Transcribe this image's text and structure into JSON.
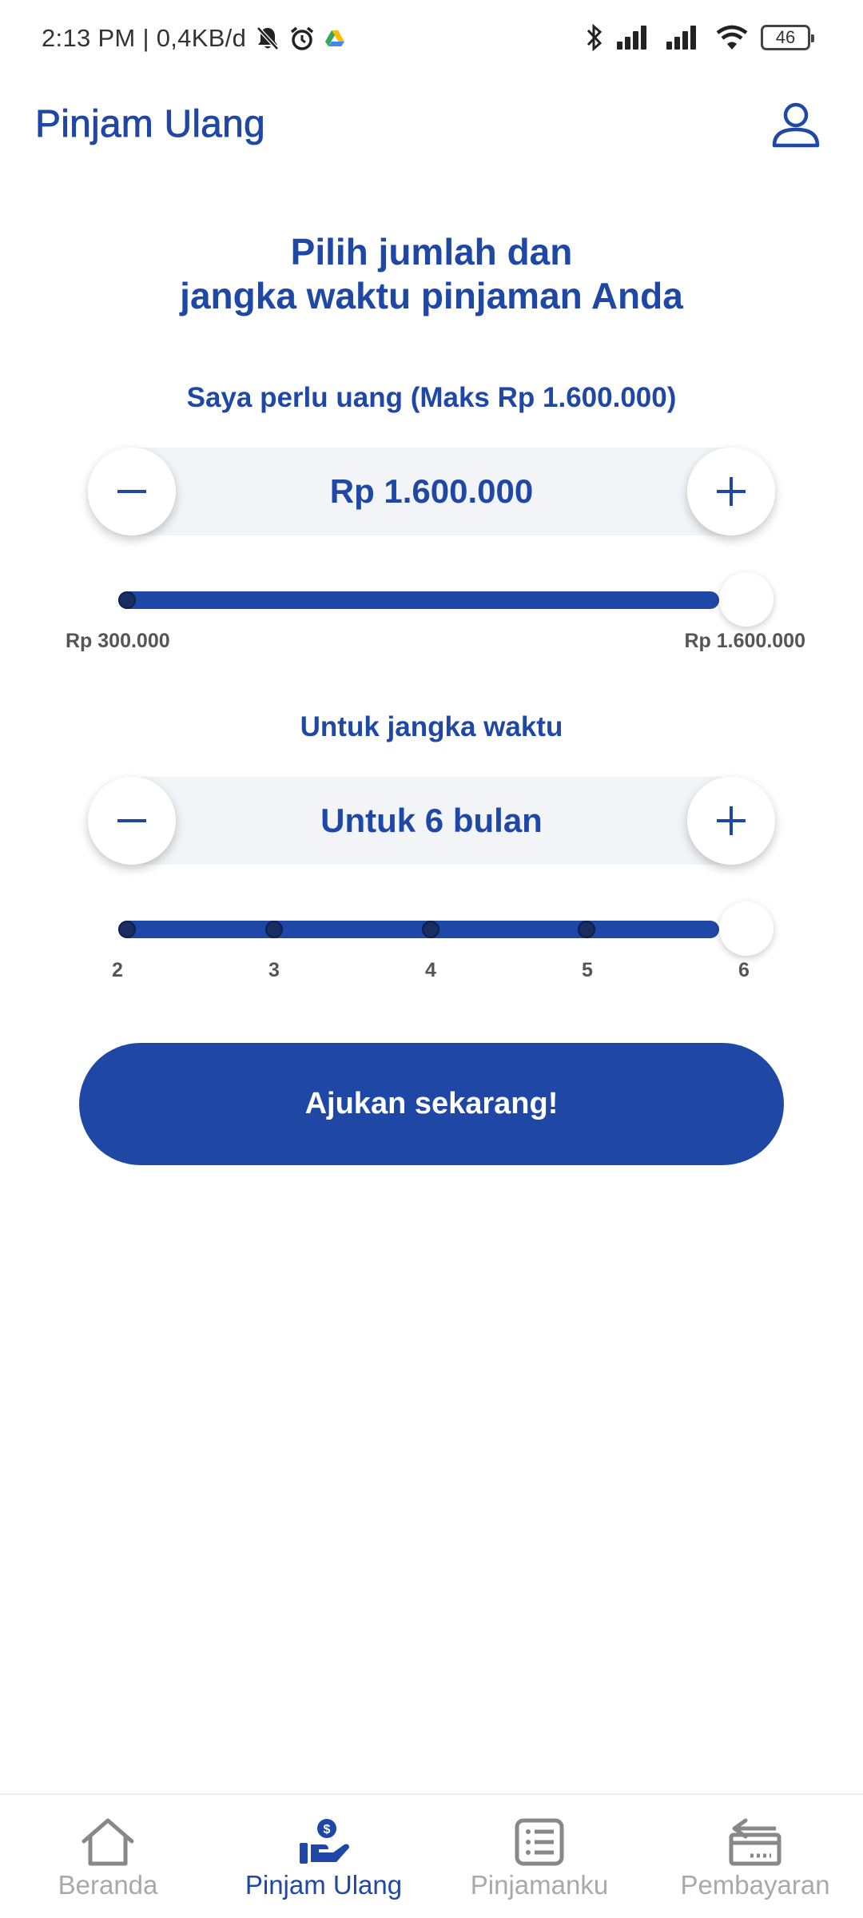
{
  "status_bar": {
    "time_network": "2:13 PM | 0,4KB/d",
    "battery": "46",
    "icons": [
      "mute-icon",
      "alarm-icon",
      "drive-icon",
      "bluetooth-icon",
      "signal-icon",
      "signal-icon",
      "wifi-icon",
      "battery-icon"
    ]
  },
  "header": {
    "title": "Pinjam Ulang",
    "profile_icon": "user-icon"
  },
  "headline": {
    "line1": "Pilih jumlah dan",
    "line2": "jangka waktu pinjaman Anda"
  },
  "amount": {
    "label": "Saya perlu uang (Maks Rp 1.600.000)",
    "value": "Rp 1.600.000",
    "min_label": "Rp 300.000",
    "max_label": "Rp 1.600.000",
    "min": 300000,
    "max": 1600000,
    "current": 1600000
  },
  "term": {
    "label": "Untuk jangka waktu",
    "value": "Untuk 6 bulan",
    "ticks": [
      "2",
      "3",
      "4",
      "5",
      "6"
    ],
    "current": 6
  },
  "submit": {
    "label": "Ajukan sekarang!"
  },
  "nav": {
    "items": [
      {
        "label": "Beranda",
        "icon": "home-icon",
        "active": false
      },
      {
        "label": "Pinjam Ulang",
        "icon": "loan-hand-icon",
        "active": true
      },
      {
        "label": "Pinjamanku",
        "icon": "list-icon",
        "active": false
      },
      {
        "label": "Pembayaran",
        "icon": "payment-icon",
        "active": false
      }
    ]
  },
  "colors": {
    "primary": "#1e47a6",
    "stepper_bg": "#f3f4f8",
    "nav_inactive": "#a9a9a9"
  }
}
